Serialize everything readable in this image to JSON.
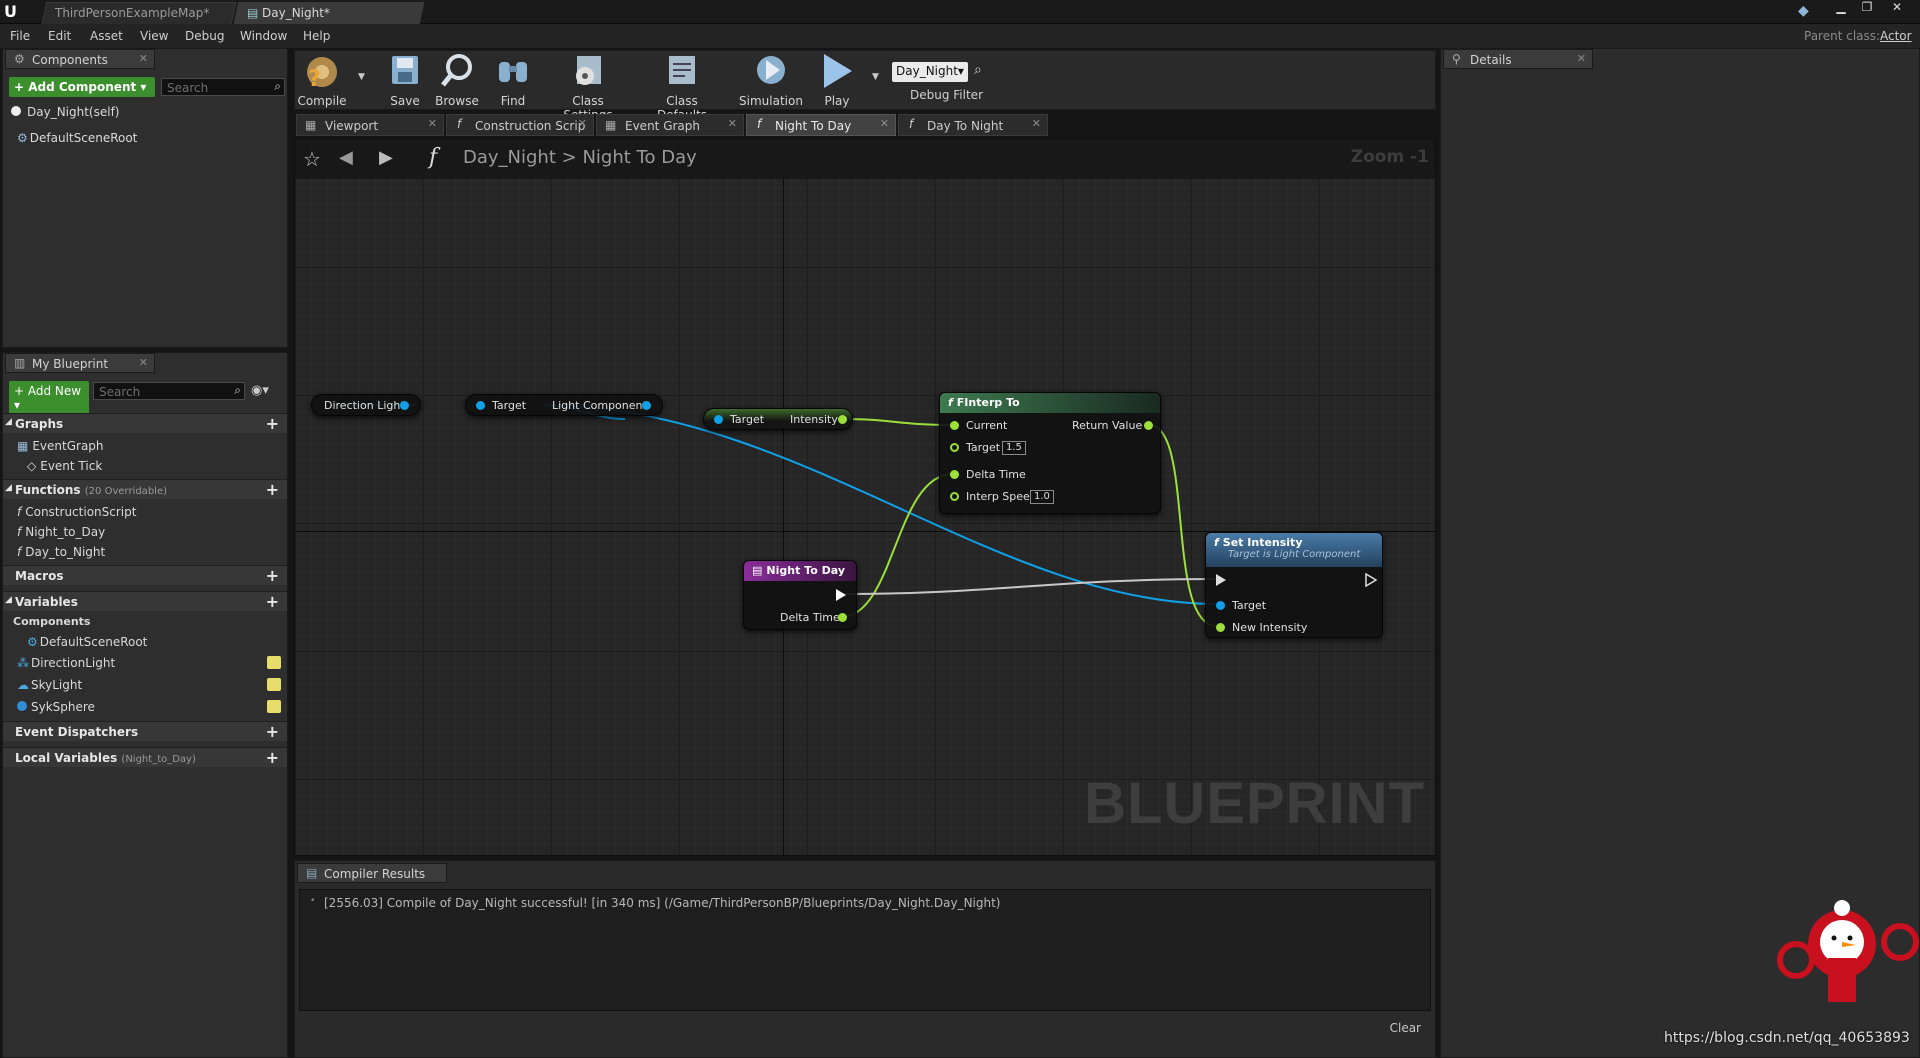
{
  "titlebar": {
    "tabs": [
      {
        "label": "ThirdPersonExampleMap*"
      },
      {
        "label": "Day_Night*"
      }
    ],
    "window_buttons": [
      "minimize",
      "restore",
      "close"
    ]
  },
  "menubar": {
    "items": [
      "File",
      "Edit",
      "Asset",
      "View",
      "Debug",
      "Window",
      "Help"
    ],
    "parent_class_label": "Parent class:",
    "parent_class_value": "Actor"
  },
  "components_panel": {
    "tab_label": "Components",
    "add_button": "+ Add Component ▾",
    "search_placeholder": "Search",
    "root_item": "Day_Night(self)",
    "child_item": "DefaultSceneRoot"
  },
  "my_blueprint": {
    "tab_label": "My Blueprint",
    "add_new": "+ Add New ▾",
    "search_placeholder": "Search",
    "sections": {
      "graphs": "Graphs",
      "functions": "Functions",
      "functions_note": "(20 Overridable)",
      "macros": "Macros",
      "variables": "Variables",
      "event_dispatchers": "Event Dispatchers",
      "local_variables": "Local Variables",
      "local_variables_note": "(Night_to_Day)"
    },
    "graph_items": [
      "EventGraph",
      "Event Tick"
    ],
    "function_items": [
      "ConstructionScript",
      "Night_to_Day",
      "Day_to_Night"
    ],
    "components_label": "Components",
    "component_vars": [
      "DefaultSceneRoot",
      "DirectionLight",
      "SkyLight",
      "SykSphere"
    ]
  },
  "toolbar": {
    "compile": "Compile",
    "save": "Save",
    "browse": "Browse",
    "find": "Find",
    "class_settings": "Class Settings",
    "class_defaults": "Class Defaults",
    "simulation": "Simulation",
    "play": "Play",
    "debug_object": "Day_Night▾",
    "debug_filter": "Debug Filter"
  },
  "editor_tabs": [
    "Viewport",
    "Construction Scrip",
    "Event Graph",
    "Night To Day",
    "Day To Night"
  ],
  "graph": {
    "breadcrumb_root": "Day_Night",
    "breadcrumb_sep": ">",
    "breadcrumb_current": "Night To Day",
    "zoom": "Zoom -1",
    "watermark": "BLUEPRINT",
    "nodes": {
      "direction_light": "Direction Light",
      "getter_target": "Target",
      "getter_output": "Light Component",
      "intensity_target": "Target",
      "intensity_output": "Intensity",
      "finterp_title": "FInterp To",
      "finterp_current": "Current",
      "finterp_target": "Target",
      "finterp_target_val": "1.5",
      "finterp_delta": "Delta Time",
      "finterp_speed": "Interp Speed",
      "finterp_speed_val": "1.0",
      "finterp_return": "Return Value",
      "entry_title": "Night To Day",
      "entry_delta": "Delta Time",
      "set_title": "Set Intensity",
      "set_subtitle": "Target is Light Component",
      "set_target": "Target",
      "set_new_intensity": "New Intensity"
    }
  },
  "compiler": {
    "tab_label": "Compiler Results",
    "message": "[2556.03] Compile of Day_Night successful! [in 340 ms] (/Game/ThirdPersonBP/Blueprints/Day_Night.Day_Night)",
    "clear": "Clear"
  },
  "details": {
    "tab_label": "Details"
  },
  "footer": {
    "watermark_url": "https://blog.csdn.net/qq_40653893"
  },
  "colors": {
    "pin_object": "#0fa0e8",
    "pin_float": "#9be03a",
    "add_green": "#3b8f2d",
    "function_header": "#2e5d8a",
    "event_header": "#6a1b7a"
  }
}
